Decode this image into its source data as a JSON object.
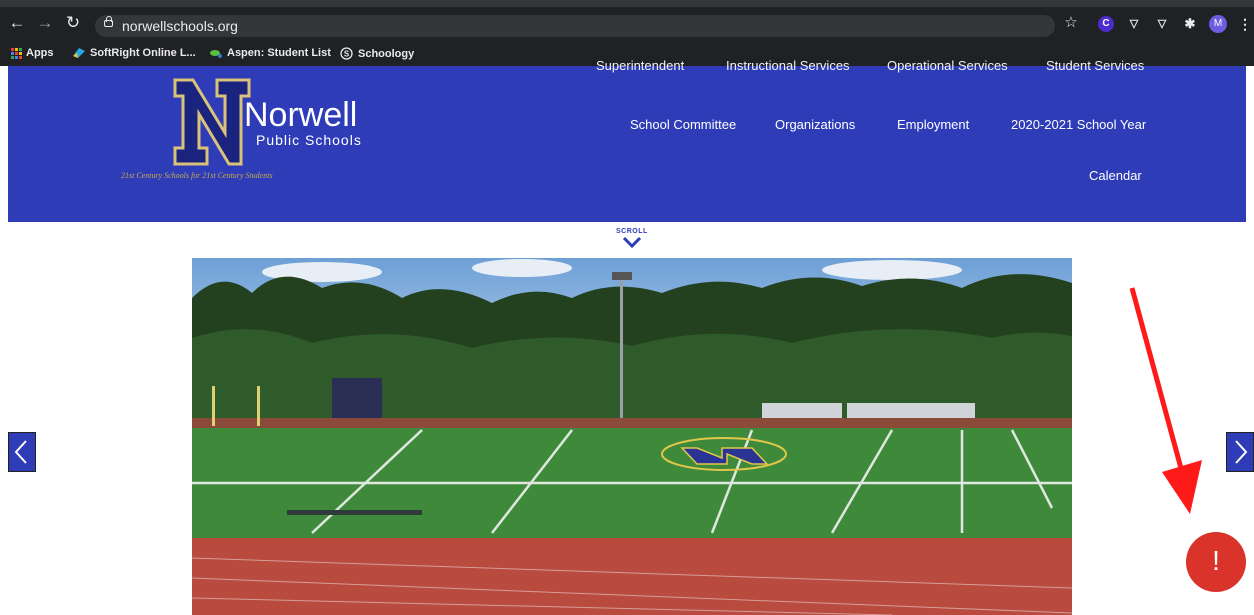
{
  "browser": {
    "url": "norwellschools.org",
    "extensions": {
      "c_label": "C",
      "avatar_label": "M"
    },
    "bookmarks": [
      {
        "label": "Apps"
      },
      {
        "label": "SoftRight Online L..."
      },
      {
        "label": "Aspen: Student List"
      },
      {
        "label": "Schoology"
      }
    ]
  },
  "site": {
    "logo_word": "Norwell",
    "logo_sub": "Public Schools",
    "tagline": "21st Century Schools for 21st Century Students",
    "nav_top_cut": [
      "Superintendent",
      "Instructional Services",
      "Operational Services",
      "Student Services"
    ],
    "nav_row": [
      "School Committee",
      "Organizations",
      "Employment",
      "2020-2021 School Year"
    ],
    "nav_calendar": "Calendar",
    "scroll_label": "SCROLL"
  },
  "alert": {
    "symbol": "!"
  },
  "colors": {
    "header_blue": "#2e3cb8",
    "chrome_dark": "#202124",
    "alert_red": "#d9332a",
    "field_green": "#3f8a3a",
    "track_red": "#b84a3e"
  }
}
